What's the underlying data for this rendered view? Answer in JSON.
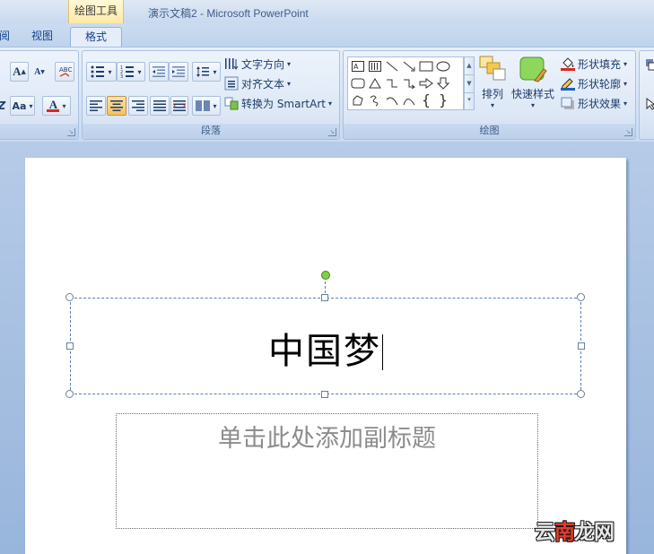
{
  "window": {
    "contextual_tab_group": "绘图工具",
    "document_title": "演示文稿2 - Microsoft PowerPoint"
  },
  "tabs": [
    {
      "label": "阅",
      "active": false
    },
    {
      "label": "视图",
      "active": false
    },
    {
      "label": "格式",
      "active": true
    }
  ],
  "ribbon": {
    "font_group": {
      "grow_font": "A",
      "shrink_font": "A",
      "change_case": "Aa",
      "font_color": "A",
      "font_color_value": "#e0251b"
    },
    "paragraph_group": {
      "label": "段落",
      "text_direction": "文字方向",
      "align_text": "对齐文本",
      "convert_smartart": "转换为 SmartArt",
      "active_alignment": "center"
    },
    "drawing_group": {
      "label": "绘图",
      "arrange": "排列",
      "quick_styles": "快速样式",
      "shape_fill": "形状填充",
      "shape_outline": "形状轮廓",
      "shape_effects": "形状效果"
    }
  },
  "slide": {
    "title_text": "中国梦",
    "subtitle_placeholder": "单击此处添加副标题"
  },
  "watermark": {
    "part1": "云",
    "part2": "南",
    "part3": "龙网"
  },
  "colors": {
    "accent_orange": "#f8c15b",
    "ribbon_blue": "#d7e4f5",
    "rotation_handle": "#7ed045"
  }
}
